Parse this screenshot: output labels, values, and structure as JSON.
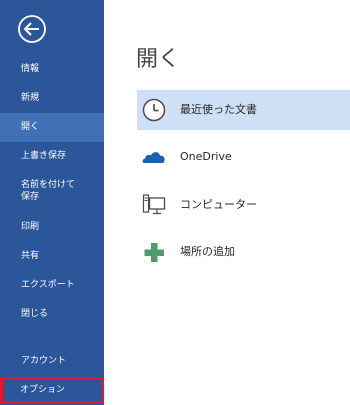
{
  "sidebar": {
    "back_icon": "back-arrow-icon",
    "items": [
      {
        "label": "情報"
      },
      {
        "label": "新規"
      },
      {
        "label": "開く"
      },
      {
        "label": "上書き保存"
      },
      {
        "label": "名前を付けて保存"
      },
      {
        "label": "印刷"
      },
      {
        "label": "共有"
      },
      {
        "label": "エクスポート"
      },
      {
        "label": "閉じる"
      },
      {
        "label": "アカウント"
      },
      {
        "label": "オプション"
      }
    ]
  },
  "main": {
    "title": "開く",
    "options": [
      {
        "label": "最近使った文書",
        "icon": "clock-icon"
      },
      {
        "label": "OneDrive",
        "icon": "cloud-icon"
      },
      {
        "label": "コンピューター",
        "icon": "computer-icon"
      },
      {
        "label": "場所の追加",
        "icon": "plus-icon"
      }
    ]
  },
  "colors": {
    "sidebar_bg": "#2b579a",
    "active_item_bg": "#4270b4",
    "highlight_border": "#e3172b",
    "selected_row_bg": "#cde0f6"
  }
}
